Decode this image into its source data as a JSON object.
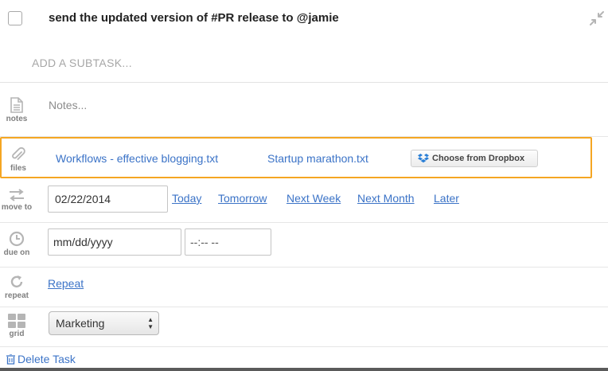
{
  "task": {
    "title": "send the updated version of #PR release to @jamie",
    "subtask_placeholder": "ADD A SUBTASK..."
  },
  "notes": {
    "label": "notes",
    "placeholder": "Notes..."
  },
  "files": {
    "label": "files",
    "items": [
      "Workflows - effective blogging.txt",
      "Startup marathon.txt"
    ],
    "dropbox_button": "Choose from Dropbox",
    "highlight_color": "#f5a623"
  },
  "move_to": {
    "label": "move to",
    "date_value": "02/22/2014",
    "quick_links": [
      "Today",
      "Tomorrow",
      "Next Week",
      "Next Month",
      "Later"
    ]
  },
  "due_on": {
    "label": "due on",
    "date_placeholder": "mm/dd/yyyy",
    "time_placeholder": "--:-- --"
  },
  "repeat": {
    "label": "repeat",
    "link": "Repeat"
  },
  "grid": {
    "label": "grid",
    "selected": "Marketing"
  },
  "footer": {
    "delete_label": "Delete Task"
  },
  "icons": {
    "collapse": "collapse-arrows-icon",
    "notes": "document-icon",
    "files": "paperclip-icon",
    "move": "swap-arrows-icon",
    "due": "clock-icon",
    "repeat": "refresh-icon",
    "grid": "grid-icon",
    "delete": "trash-icon",
    "dropbox": "dropbox-icon"
  },
  "colors": {
    "link": "#3b73c7",
    "icon": "#b5b5b5"
  }
}
